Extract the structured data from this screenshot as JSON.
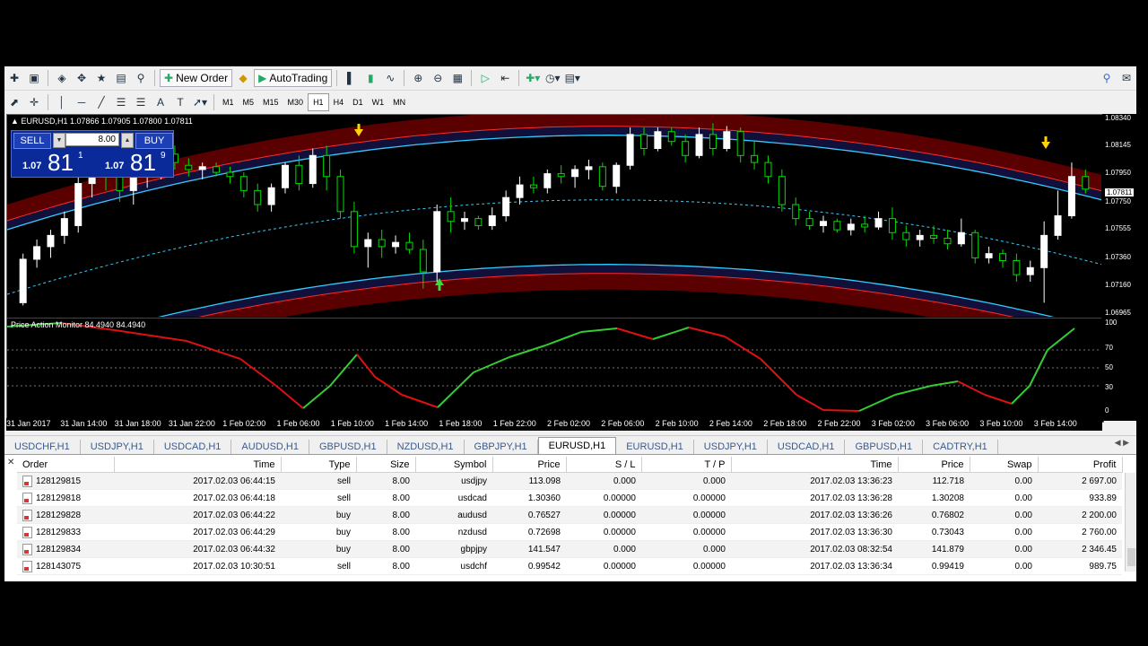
{
  "toolbar": {
    "new_order_label": "New Order",
    "autotrading_label": "AutoTrading",
    "timeframes": [
      "M1",
      "M5",
      "M15",
      "M30",
      "H1",
      "H4",
      "D1",
      "W1",
      "MN"
    ],
    "active_timeframe": "H1"
  },
  "chart": {
    "header": "EURUSD,H1",
    "ohlc": "1.07866 1.07905 1.07800 1.07811",
    "oscillator_label": "Price Action Monitor 84.4940 84.4940",
    "trade_panel": {
      "sell_label": "SELL",
      "buy_label": "BUY",
      "lot": "8.00",
      "sell_prefix": "1.07",
      "sell_big": "81",
      "sell_sup": "1",
      "buy_prefix": "1.07",
      "buy_big": "81",
      "buy_sup": "9"
    },
    "price_scale": [
      "1.08340",
      "1.08145",
      "1.07950",
      "1.07750",
      "1.07555",
      "1.07360",
      "1.07160",
      "1.06965"
    ],
    "current_price": "1.07811",
    "osc_scale": [
      "100",
      "70",
      "50",
      "30",
      "0"
    ],
    "time_labels": [
      "31 Jan 2017",
      "31 Jan 14:00",
      "31 Jan 18:00",
      "31 Jan 22:00",
      "1 Feb 02:00",
      "1 Feb 06:00",
      "1 Feb 10:00",
      "1 Feb 14:00",
      "1 Feb 18:00",
      "1 Feb 22:00",
      "2 Feb 02:00",
      "2 Feb 06:00",
      "2 Feb 10:00",
      "2 Feb 14:00",
      "2 Feb 18:00",
      "2 Feb 22:00",
      "3 Feb 02:00",
      "3 Feb 06:00",
      "3 Feb 10:00",
      "3 Feb 14:00"
    ],
    "colors": {
      "band_outer": "#5a0000",
      "band_inner": "#10103a",
      "bull": "#00dd00",
      "bear": "#ffffff",
      "osc_up": "#33cc33",
      "osc_down": "#dd1111"
    }
  },
  "tabs": [
    "USDCHF,H1",
    "USDJPY,H1",
    "USDCAD,H1",
    "AUDUSD,H1",
    "GBPUSD,H1",
    "NZDUSD,H1",
    "GBPJPY,H1",
    "EURUSD,H1",
    "EURUSD,H1",
    "USDJPY,H1",
    "USDCAD,H1",
    "GBPUSD,H1",
    "CADTRY,H1"
  ],
  "active_tab_index": 7,
  "terminal": {
    "headers": [
      "Order",
      "Time",
      "Type",
      "Size",
      "Symbol",
      "Price",
      "S / L",
      "T / P",
      "Time",
      "Price",
      "Swap",
      "Profit"
    ],
    "rows": [
      [
        "128129815",
        "2017.02.03 06:44:15",
        "sell",
        "8.00",
        "usdjpy",
        "113.098",
        "0.000",
        "0.000",
        "2017.02.03 13:36:23",
        "112.718",
        "0.00",
        "2 697.00"
      ],
      [
        "128129818",
        "2017.02.03 06:44:18",
        "sell",
        "8.00",
        "usdcad",
        "1.30360",
        "0.00000",
        "0.00000",
        "2017.02.03 13:36:28",
        "1.30208",
        "0.00",
        "933.89"
      ],
      [
        "128129828",
        "2017.02.03 06:44:22",
        "buy",
        "8.00",
        "audusd",
        "0.76527",
        "0.00000",
        "0.00000",
        "2017.02.03 13:36:26",
        "0.76802",
        "0.00",
        "2 200.00"
      ],
      [
        "128129833",
        "2017.02.03 06:44:29",
        "buy",
        "8.00",
        "nzdusd",
        "0.72698",
        "0.00000",
        "0.00000",
        "2017.02.03 13:36:30",
        "0.73043",
        "0.00",
        "2 760.00"
      ],
      [
        "128129834",
        "2017.02.03 06:44:32",
        "buy",
        "8.00",
        "gbpjpy",
        "141.547",
        "0.000",
        "0.000",
        "2017.02.03 08:32:54",
        "141.879",
        "0.00",
        "2 346.45"
      ],
      [
        "128143075",
        "2017.02.03 10:30:51",
        "sell",
        "8.00",
        "usdchf",
        "0.99542",
        "0.00000",
        "0.00000",
        "2017.02.03 13:36:34",
        "0.99419",
        "0.00",
        "989.75"
      ]
    ]
  },
  "chart_data": {
    "type": "candlestick",
    "symbol": "EURUSD,H1",
    "ylim": [
      1.069,
      1.0834
    ],
    "candles": [
      [
        1.07,
        1.0735,
        1.0698,
        1.0731
      ],
      [
        1.0731,
        1.0745,
        1.0725,
        1.074
      ],
      [
        1.074,
        1.0752,
        1.0732,
        1.0748
      ],
      [
        1.0748,
        1.0765,
        1.0742,
        1.076
      ],
      [
        1.0755,
        1.079,
        1.075,
        1.0785
      ],
      [
        1.0785,
        1.08,
        1.0775,
        1.0795
      ],
      [
        1.0795,
        1.0803,
        1.078,
        1.079
      ],
      [
        1.079,
        1.08,
        1.0772,
        1.078
      ],
      [
        1.078,
        1.0798,
        1.077,
        1.0793
      ],
      [
        1.0793,
        1.0802,
        1.0782,
        1.0795
      ],
      [
        1.0795,
        1.081,
        1.0788,
        1.0806
      ],
      [
        1.0806,
        1.0812,
        1.0795,
        1.08
      ],
      [
        1.0798,
        1.0803,
        1.079,
        1.0795
      ],
      [
        1.0795,
        1.08,
        1.0788,
        1.0797
      ],
      [
        1.0797,
        1.08,
        1.079,
        1.0793
      ],
      [
        1.0793,
        1.0797,
        1.0785,
        1.079
      ],
      [
        1.079,
        1.0793,
        1.0775,
        1.078
      ],
      [
        1.078,
        1.0785,
        1.0765,
        1.077
      ],
      [
        1.077,
        1.0785,
        1.0765,
        1.0782
      ],
      [
        1.0782,
        1.08,
        1.0778,
        1.0798
      ],
      [
        1.0798,
        1.0805,
        1.078,
        1.0785
      ],
      [
        1.0785,
        1.081,
        1.0782,
        1.0805
      ],
      [
        1.0805,
        1.0812,
        1.078,
        1.079
      ],
      [
        1.079,
        1.0795,
        1.076,
        1.0765
      ],
      [
        1.0765,
        1.0772,
        1.0735,
        1.074
      ],
      [
        1.074,
        1.075,
        1.0725,
        1.0745
      ],
      [
        1.0745,
        1.0752,
        1.0732,
        1.074
      ],
      [
        1.074,
        1.0748,
        1.0735,
        1.0743
      ],
      [
        1.0743,
        1.075,
        1.0735,
        1.0738
      ],
      [
        1.0738,
        1.0745,
        1.071,
        1.0722
      ],
      [
        1.0722,
        1.077,
        1.0715,
        1.0765
      ],
      [
        1.0765,
        1.0775,
        1.075,
        1.0758
      ],
      [
        1.0758,
        1.0765,
        1.0752,
        1.076
      ],
      [
        1.076,
        1.0762,
        1.0752,
        1.0755
      ],
      [
        1.0755,
        1.0768,
        1.0752,
        1.0762
      ],
      [
        1.0762,
        1.078,
        1.0758,
        1.0775
      ],
      [
        1.0775,
        1.079,
        1.077,
        1.0784
      ],
      [
        1.0784,
        1.079,
        1.0778,
        1.0782
      ],
      [
        1.0782,
        1.0795,
        1.0778,
        1.0792
      ],
      [
        1.0792,
        1.0798,
        1.0785,
        1.079
      ],
      [
        1.079,
        1.0798,
        1.0782,
        1.0795
      ],
      [
        1.0795,
        1.0802,
        1.0788,
        1.0797
      ],
      [
        1.0797,
        1.08,
        1.078,
        1.0783
      ],
      [
        1.0783,
        1.08,
        1.0778,
        1.0798
      ],
      [
        1.0798,
        1.0825,
        1.0795,
        1.082
      ],
      [
        1.082,
        1.0825,
        1.0805,
        1.081
      ],
      [
        1.081,
        1.0825,
        1.0808,
        1.0822
      ],
      [
        1.0822,
        1.0825,
        1.0812,
        1.0815
      ],
      [
        1.0815,
        1.082,
        1.08,
        1.0805
      ],
      [
        1.0805,
        1.0825,
        1.0803,
        1.082
      ],
      [
        1.082,
        1.0828,
        1.0805,
        1.081
      ],
      [
        1.081,
        1.0826,
        1.0808,
        1.0822
      ],
      [
        1.0822,
        1.0825,
        1.08,
        1.0805
      ],
      [
        1.0805,
        1.0815,
        1.0795,
        1.08
      ],
      [
        1.08,
        1.0805,
        1.0785,
        1.079
      ],
      [
        1.079,
        1.0795,
        1.0765,
        1.077
      ],
      [
        1.077,
        1.0775,
        1.0755,
        1.076
      ],
      [
        1.076,
        1.0765,
        1.0752,
        1.0755
      ],
      [
        1.0755,
        1.0762,
        1.075,
        1.0758
      ],
      [
        1.0758,
        1.076,
        1.075,
        1.0752
      ],
      [
        1.0752,
        1.076,
        1.0748,
        1.0756
      ],
      [
        1.0756,
        1.0762,
        1.075,
        1.0754
      ],
      [
        1.0754,
        1.0765,
        1.0752,
        1.076
      ],
      [
        1.076,
        1.0768,
        1.0745,
        1.075
      ],
      [
        1.075,
        1.0755,
        1.074,
        1.0745
      ],
      [
        1.0745,
        1.0752,
        1.074,
        1.0748
      ],
      [
        1.0748,
        1.0755,
        1.0742,
        1.0746
      ],
      [
        1.0746,
        1.0752,
        1.0738,
        1.0742
      ],
      [
        1.0742,
        1.076,
        1.074,
        1.075
      ],
      [
        1.075,
        1.0752,
        1.0728,
        1.0732
      ],
      [
        1.0732,
        1.074,
        1.0728,
        1.0735
      ],
      [
        1.0735,
        1.0738,
        1.0725,
        1.073
      ],
      [
        1.073,
        1.0735,
        1.0715,
        1.072
      ],
      [
        1.072,
        1.073,
        1.0715,
        1.0725
      ],
      [
        1.0725,
        1.0758,
        1.07,
        1.0748
      ],
      [
        1.0748,
        1.078,
        1.0745,
        1.0762
      ],
      [
        1.0762,
        1.08,
        1.076,
        1.079
      ],
      [
        1.079,
        1.0795,
        1.0778,
        1.0781
      ]
    ],
    "oscillator": {
      "ylim": [
        0,
        100
      ]
    }
  }
}
